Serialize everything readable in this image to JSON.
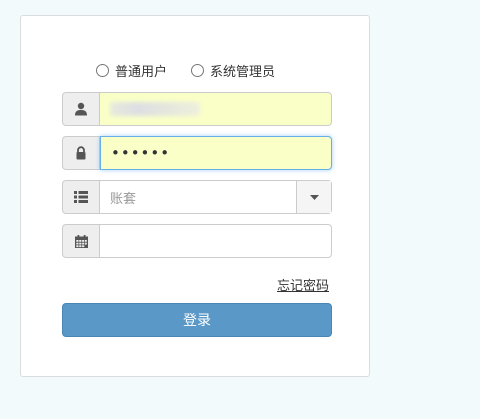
{
  "roles": [
    {
      "label": "普通用户"
    },
    {
      "label": "系统管理员"
    }
  ],
  "fields": {
    "username": {
      "icon": "user-icon"
    },
    "password": {
      "icon": "lock-icon",
      "value": "••••••"
    },
    "account_set": {
      "icon": "list-icon",
      "placeholder": "账套"
    },
    "date": {
      "icon": "calendar-icon",
      "value": ""
    }
  },
  "forgot_password_label": "忘记密码",
  "login_label": "登录",
  "colors": {
    "page_background": "#f2fafc",
    "primary_button": "#5a98c8",
    "autofill": "#faffc8",
    "focus_border": "#66afe9"
  }
}
